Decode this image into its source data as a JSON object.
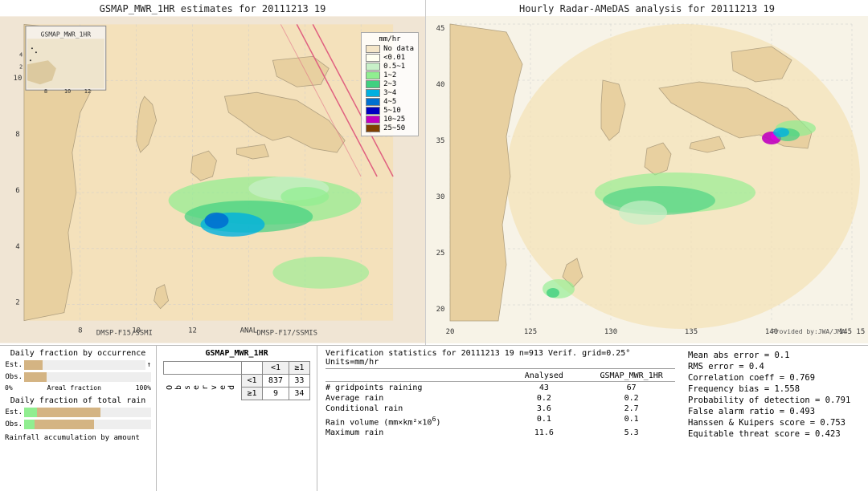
{
  "left_map": {
    "title": "GSMAP_MWR_1HR estimates for 20111213 19",
    "satellite_label_bottom_left": "DMSP-F15/SSMI",
    "satellite_label_bottom_right": "DMSP-F17/SSMIS"
  },
  "right_map": {
    "title": "Hourly Radar-AMeDAS analysis for 20111213 19",
    "credit": "Provided by:JWA/JMA"
  },
  "legend": {
    "title": "mm/hr",
    "items": [
      {
        "label": "No data",
        "color": "#f5e6c8"
      },
      {
        "label": "<0.01",
        "color": "#fffff0"
      },
      {
        "label": "0.5~1",
        "color": "#c8f0c8"
      },
      {
        "label": "1~2",
        "color": "#90ee90"
      },
      {
        "label": "2~3",
        "color": "#40d080"
      },
      {
        "label": "3~4",
        "color": "#00b0e0"
      },
      {
        "label": "4~5",
        "color": "#0070d0"
      },
      {
        "label": "5~10",
        "color": "#0000c0"
      },
      {
        "label": "10~25",
        "color": "#c000c0"
      },
      {
        "label": "25~50",
        "color": "#804000"
      }
    ]
  },
  "bottom_left": {
    "title1": "Daily fraction by occurrence",
    "bar1_label_est": "Est.",
    "bar1_label_obs": "Obs.",
    "axis_left": "0%",
    "axis_label": "Areal fraction",
    "axis_right": "100%",
    "title2": "Daily fraction of total rain",
    "bar2_label_est": "Est.",
    "bar2_label_obs": "Obs.",
    "footer": "Rainfall accumulation by amount"
  },
  "contingency_table": {
    "title": "GSMAP_MWR_1HR",
    "col_headers": [
      "<1",
      "≥1"
    ],
    "row_header_label": "O\nb\ns\ne\nr\nv\ne\nd",
    "rows": [
      {
        "label": "<1",
        "values": [
          "837",
          "33"
        ]
      },
      {
        "label": "≥1",
        "values": [
          "9",
          "34"
        ]
      }
    ]
  },
  "verification": {
    "header": "Verification statistics for 20111213 19  n=913  Verif. grid=0.25°  Units=mm/hr",
    "col_headers": [
      "Analysed",
      "GSMAP_MWR_1HR"
    ],
    "rows": [
      {
        "label": "# gridpoints raining",
        "val1": "43",
        "val2": "67"
      },
      {
        "label": "Average rain",
        "val1": "0.2",
        "val2": "0.2"
      },
      {
        "label": "Conditional rain",
        "val1": "3.6",
        "val2": "2.7"
      },
      {
        "label": "Rain volume (mm×km²×10⁶)",
        "val1": "0.1",
        "val2": "0.1"
      },
      {
        "label": "Maximum rain",
        "val1": "11.6",
        "val2": "5.3"
      }
    ],
    "separator": "--------------------------------------------"
  },
  "right_stats": {
    "lines": [
      "Mean abs error = 0.1",
      "RMS error = 0.4",
      "Correlation coeff = 0.769",
      "Frequency bias = 1.558",
      "Probability of detection = 0.791",
      "False alarm ratio = 0.493",
      "Hanssen & Kuipers score = 0.753",
      "Equitable threat score = 0.423"
    ]
  }
}
